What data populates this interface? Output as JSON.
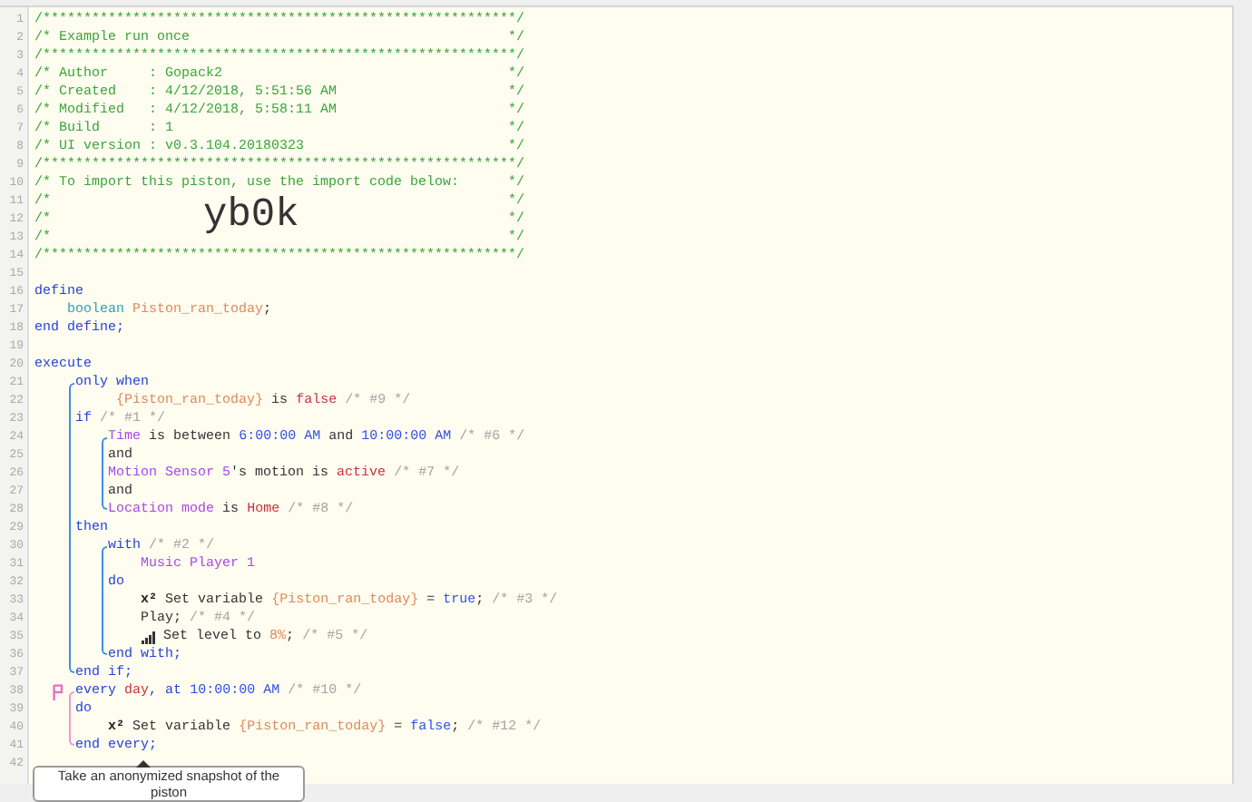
{
  "lines": [
    {
      "n": "1",
      "marked": false,
      "tokens": [
        {
          "kind": "comment_block",
          "text": "/**********************************************************/"
        }
      ]
    },
    {
      "n": "2",
      "marked": false,
      "tokens": [
        {
          "kind": "comment_block",
          "text": "/* Example run once"
        }
      ],
      "end": "*/"
    },
    {
      "n": "3",
      "marked": false,
      "tokens": [
        {
          "kind": "comment_block",
          "text": "/**********************************************************/"
        }
      ]
    },
    {
      "n": "4",
      "marked": false,
      "tokens": [
        {
          "kind": "comment_block",
          "text": "/* Author     : Gopack2"
        }
      ],
      "end": "*/"
    },
    {
      "n": "5",
      "marked": false,
      "tokens": [
        {
          "kind": "comment_block",
          "text": "/* Created    : 4/12/2018, 5:51:56 AM"
        }
      ],
      "end": "*/"
    },
    {
      "n": "6",
      "marked": false,
      "tokens": [
        {
          "kind": "comment_block",
          "text": "/* Modified   : 4/12/2018, 5:58:11 AM"
        }
      ],
      "end": "*/"
    },
    {
      "n": "7",
      "marked": false,
      "tokens": [
        {
          "kind": "comment_block",
          "text": "/* Build      : 1"
        }
      ],
      "end": "*/"
    },
    {
      "n": "8",
      "marked": false,
      "tokens": [
        {
          "kind": "comment_block",
          "text": "/* UI version : v0.3.104.20180323"
        }
      ],
      "end": "*/"
    },
    {
      "n": "9",
      "marked": false,
      "tokens": [
        {
          "kind": "comment_block",
          "text": "/**********************************************************/"
        }
      ]
    },
    {
      "n": "10",
      "marked": false,
      "tokens": [
        {
          "kind": "comment_block",
          "text": "/* To import this piston, use the import code below:"
        }
      ],
      "end": "*/"
    },
    {
      "n": "11",
      "marked": false,
      "tokens": [
        {
          "kind": "comment_block",
          "text": "/*"
        }
      ],
      "end": "*/"
    },
    {
      "n": "12",
      "marked": false,
      "tokens": [
        {
          "kind": "comment_block",
          "text": "/*"
        },
        {
          "kind": "import_code",
          "text": "yb0k"
        }
      ],
      "end": "*/"
    },
    {
      "n": "13",
      "marked": false,
      "tokens": [
        {
          "kind": "comment_block",
          "text": "/*"
        }
      ],
      "end": "*/"
    },
    {
      "n": "14",
      "marked": false,
      "tokens": [
        {
          "kind": "comment_block",
          "text": "/**********************************************************/"
        }
      ]
    },
    {
      "n": "15",
      "marked": false
    },
    {
      "n": "16",
      "marked": false,
      "tokens": [
        {
          "kind": "keyword",
          "text": "define"
        }
      ]
    },
    {
      "n": "17",
      "marked": false,
      "tokens": [
        {
          "kind": "type",
          "text": "    boolean "
        },
        {
          "kind": "variable",
          "text": "Piston_ran_today"
        },
        {
          "kind": "plain",
          "text": ";"
        }
      ]
    },
    {
      "n": "18",
      "marked": false,
      "tokens": [
        {
          "kind": "keyword",
          "text": "end define;"
        }
      ]
    },
    {
      "n": "19",
      "marked": false
    },
    {
      "n": "20",
      "marked": false,
      "tokens": [
        {
          "kind": "keyword",
          "text": "execute"
        }
      ]
    },
    {
      "kind": "group",
      "color": "#3d8fe0",
      "lines": [
        {
          "n": "21",
          "marked": false,
          "tokens": [
            {
              "kind": "keyword",
              "text": "     only when"
            }
          ]
        },
        {
          "n": "22",
          "marked": false,
          "tokens": [
            {
              "kind": "variable",
              "text": "          {Piston_ran_today}"
            },
            {
              "kind": "plain",
              "text": " is "
            },
            {
              "kind": "value",
              "text": "false"
            },
            {
              "kind": "comment",
              "text": " /* #9 */"
            }
          ]
        },
        {
          "n": "23",
          "marked": false,
          "tokens": [
            {
              "kind": "keyword",
              "text": "     if"
            },
            {
              "kind": "comment",
              "text": " /* #1 */"
            }
          ]
        },
        {
          "kind": "group",
          "color": "#3d8fe0",
          "lines": [
            {
              "n": "24",
              "marked": false,
              "tokens": [
                {
                  "kind": "device",
                  "text": "         Time"
                },
                {
                  "kind": "plain",
                  "text": " is between "
                },
                {
                  "kind": "constant",
                  "text": "6:00:00 AM"
                },
                {
                  "kind": "plain",
                  "text": " and "
                },
                {
                  "kind": "constant",
                  "text": "10:00:00 AM"
                },
                {
                  "kind": "comment",
                  "text": " /* #6 */"
                }
              ]
            },
            {
              "n": "25",
              "marked": false,
              "tokens": [
                {
                  "kind": "plain",
                  "text": "         and"
                }
              ]
            },
            {
              "n": "26",
              "marked": false,
              "tokens": [
                {
                  "kind": "device",
                  "text": "         Motion Sensor 5"
                },
                {
                  "kind": "plain",
                  "text": "'s motion is "
                },
                {
                  "kind": "value",
                  "text": "active"
                },
                {
                  "kind": "comment",
                  "text": " /* #7 */"
                }
              ]
            },
            {
              "n": "27",
              "marked": false,
              "tokens": [
                {
                  "kind": "plain",
                  "text": "         and"
                }
              ]
            },
            {
              "n": "28",
              "marked": false,
              "tokens": [
                {
                  "kind": "device",
                  "text": "         Location mode"
                },
                {
                  "kind": "plain",
                  "text": " is "
                },
                {
                  "kind": "value",
                  "text": "Home"
                },
                {
                  "kind": "comment",
                  "text": " /* #8 */"
                }
              ]
            }
          ]
        },
        {
          "n": "29",
          "marked": false,
          "tokens": [
            {
              "kind": "keyword",
              "text": "     then"
            }
          ]
        },
        {
          "kind": "group",
          "color": "#3d8fe0",
          "lines": [
            {
              "n": "30",
              "marked": false,
              "tokens": [
                {
                  "kind": "keyword",
                  "text": "         with"
                },
                {
                  "kind": "comment",
                  "text": " /* #2 */"
                }
              ]
            },
            {
              "n": "31",
              "marked": false,
              "tokens": [
                {
                  "kind": "device",
                  "text": "             Music Player 1"
                }
              ]
            },
            {
              "n": "32",
              "marked": false,
              "tokens": [
                {
                  "kind": "keyword",
                  "text": "         do"
                }
              ]
            },
            {
              "n": "33",
              "marked": false,
              "tokens": [
                {
                  "kind": "bold",
                  "text": "             x²"
                },
                {
                  "kind": "plain",
                  "text": " Set variable "
                },
                {
                  "kind": "variable",
                  "text": "{Piston_ran_today}"
                },
                {
                  "kind": "plain",
                  "text": " = "
                },
                {
                  "kind": "constant",
                  "text": "true"
                },
                {
                  "kind": "plain",
                  "text": ";"
                },
                {
                  "kind": "comment",
                  "text": " /* #3 */"
                }
              ]
            },
            {
              "n": "34",
              "marked": false,
              "tokens": [
                {
                  "kind": "plain",
                  "text": "             Play;"
                },
                {
                  "kind": "comment",
                  "text": " /* #4 */"
                }
              ]
            },
            {
              "n": "35",
              "marked": false,
              "tokens": [
                {
                  "kind": "signal_icon"
                },
                {
                  "kind": "plain",
                  "text": " Set level to "
                },
                {
                  "kind": "variable",
                  "text": "8%"
                },
                {
                  "kind": "plain",
                  "text": ";"
                },
                {
                  "kind": "comment",
                  "text": " /* #5 */"
                }
              ]
            },
            {
              "n": "36",
              "marked": false,
              "tokens": [
                {
                  "kind": "keyword",
                  "text": "         end with;"
                }
              ]
            }
          ]
        },
        {
          "n": "37",
          "marked": false,
          "tokens": [
            {
              "kind": "keyword",
              "text": "     end if;"
            }
          ]
        }
      ]
    },
    {
      "kind": "group",
      "color": "#e79bd2",
      "lines": [
        {
          "n": "38",
          "marked": true,
          "tokens": [
            {
              "kind": "keyword",
              "text": "     every "
            },
            {
              "kind": "value",
              "text": "day"
            },
            {
              "kind": "keyword",
              "text": ", at "
            },
            {
              "kind": "constant",
              "text": "10:00:00 AM"
            },
            {
              "kind": "comment",
              "text": " /* #10 */"
            }
          ]
        },
        {
          "n": "39",
          "marked": false,
          "tokens": [
            {
              "kind": "keyword",
              "text": "     do"
            }
          ]
        },
        {
          "n": "40",
          "marked": false,
          "tokens": [
            {
              "kind": "bold",
              "text": "         x²"
            },
            {
              "kind": "plain",
              "text": " Set variable "
            },
            {
              "kind": "variable",
              "text": "{Piston_ran_today}"
            },
            {
              "kind": "plain",
              "text": " = "
            },
            {
              "kind": "constant",
              "text": "false"
            },
            {
              "kind": "plain",
              "text": ";"
            },
            {
              "kind": "comment",
              "text": " /* #12 */"
            }
          ]
        },
        {
          "n": "41",
          "marked": false,
          "tokens": [
            {
              "kind": "keyword",
              "text": "     end every;"
            }
          ]
        }
      ]
    },
    {
      "n": "42",
      "marked": false
    }
  ],
  "tooltip": {
    "text": "Take an anonymized snapshot of the piston"
  }
}
